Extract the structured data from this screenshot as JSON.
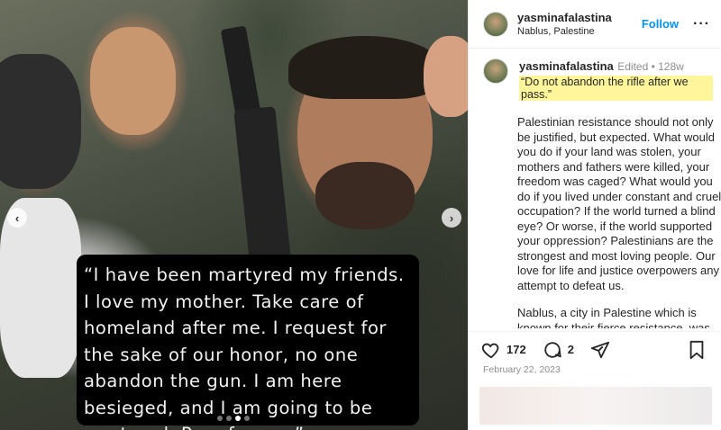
{
  "post": {
    "caption_overlay": "“I have been martyred my friends. I love my mother. Take care of homeland after me. I request for the sake of our honor, no one abandon the gun. I am here besieged, and I am going to be martyred. Pray for me.”",
    "carousel": {
      "current": 3,
      "total": 4
    }
  },
  "header": {
    "username": "yasminafalastina",
    "location": "Nablus, Palestine",
    "follow_label": "Follow",
    "more_label": "···"
  },
  "comment": {
    "username": "yasminafalastina",
    "meta": "Edited • 128w",
    "quote": "“Do not abandon the rifle after we pass.”",
    "paragraph1": "Palestinian resistance should not only be justified, but expected. What would you do if your land was stolen, your mothers and fathers were killed, your freedom was caged? What would you do if you lived under constant and cruel occupation? If the world turned a blind eye? Or worse, if the world supported your oppression? Palestinians are the strongest and most loving people. Our love for life and justice overpowers any attempt to defeat us.",
    "paragraph2": "Nablus, a city in Palestine which is known for their fierce resistance, was raided today. Israeli Occupation Forces"
  },
  "actions": {
    "likes": "172",
    "comments": "2"
  },
  "date": "February 22, 2023",
  "icons": {
    "like": "heart-icon",
    "comment": "comment-bubble-icon",
    "share": "paper-plane-icon",
    "save": "bookmark-icon",
    "prev": "chevron-left-icon",
    "next": "chevron-right-icon"
  },
  "colors": {
    "follow": "#0095f6",
    "highlight": "#fff59a"
  }
}
